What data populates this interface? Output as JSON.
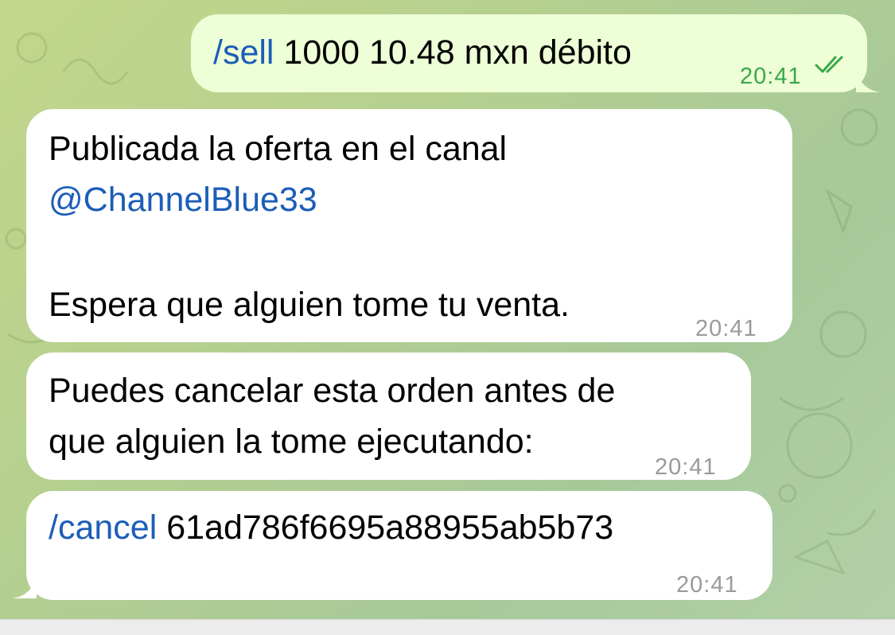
{
  "messages": {
    "sent": {
      "command": "/sell",
      "text": " 1000 10.48 mxn débito",
      "time": "20:41"
    },
    "reply1": {
      "line1": "Publicada la oferta en el canal",
      "channel": "@ChannelBlue33",
      "line3": "Espera que alguien tome tu venta.",
      "time": "20:41"
    },
    "reply2": {
      "line1": "Puedes cancelar esta orden antes de",
      "line2": "que alguien la tome ejecutando:",
      "time": "20:41"
    },
    "reply3": {
      "command": "/cancel",
      "order_id": " 61ad786f6695a88955ab5b73",
      "time": "20:41"
    }
  },
  "colors": {
    "outgoing_bubble": "#eefed6",
    "incoming_bubble": "#ffffff",
    "link": "#1c5db8",
    "read_check": "#3aa84a"
  },
  "icons": {
    "read_status": "double-check-icon"
  }
}
